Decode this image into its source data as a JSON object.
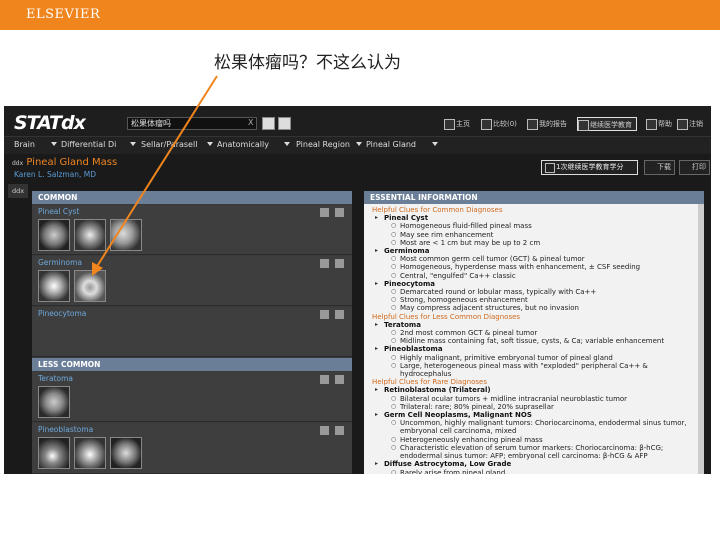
{
  "slide": {
    "brand": "ELSEVIER",
    "caption": "松果体瘤吗？不这么认为",
    "accent_color": "#f0851e"
  },
  "app": {
    "logo": "STATdx",
    "search_value": "松果体瘤吗",
    "search_clear": "X",
    "header_buttons": [
      "主页",
      "比较(0)",
      "我的报告",
      "继续医学教育",
      "帮助",
      "注销"
    ],
    "nav": [
      "Brain",
      "Differential Di",
      "Sellar/Parasell",
      "Anatomically",
      "Pineal Region",
      "Pineal Gland"
    ],
    "title_prefix": "ddx",
    "title": "Pineal Gland Mass",
    "author": "Karen L. Salzman, MD",
    "tm_button": "1次继续医学教育学分",
    "small_buttons": [
      "下载",
      "打印"
    ],
    "side_tab": "ddx"
  },
  "left": {
    "common_header": "COMMON",
    "less_common_header": "LESS COMMON",
    "common": [
      "Pineal Cyst",
      "Germinoma",
      "Pineocytoma"
    ],
    "less_common": [
      "Teratoma",
      "Pineoblastoma"
    ]
  },
  "right": {
    "header": "ESSENTIAL INFORMATION",
    "lines": [
      {
        "t": "h",
        "s": "Helpful Clues for Common Diagnoses"
      },
      {
        "t": "l1",
        "s": "Pineal Cyst"
      },
      {
        "t": "l2",
        "s": "Homogeneous fluid-filled pineal mass"
      },
      {
        "t": "l2",
        "s": "May see rim enhancement"
      },
      {
        "t": "l2",
        "s": "Most are < 1 cm but may be up to 2 cm"
      },
      {
        "t": "l1",
        "s": "Germinoma"
      },
      {
        "t": "l2",
        "s": "Most common germ cell tumor (GCT) & pineal tumor"
      },
      {
        "t": "l2",
        "s": "Homogeneous, hyperdense mass with enhancement, ± CSF seeding"
      },
      {
        "t": "l2",
        "s": "Central, \"engulfed\" Ca++ classic"
      },
      {
        "t": "l1",
        "s": "Pineocytoma"
      },
      {
        "t": "l2",
        "s": "Demarcated round or lobular mass, typically with Ca++"
      },
      {
        "t": "l2",
        "s": "Strong, homogeneous enhancement"
      },
      {
        "t": "l2",
        "s": "May compress adjacent structures, but no invasion"
      },
      {
        "t": "h",
        "s": "Helpful Clues for Less Common Diagnoses"
      },
      {
        "t": "l1",
        "s": "Teratoma"
      },
      {
        "t": "l2",
        "s": "2nd most common GCT & pineal tumor"
      },
      {
        "t": "l2",
        "s": "Midline mass containing fat, soft tissue, cysts, & Ca; variable enhancement"
      },
      {
        "t": "l1",
        "s": "Pineoblastoma"
      },
      {
        "t": "l2",
        "s": "Highly malignant, primitive embryonal tumor of pineal gland"
      },
      {
        "t": "l2",
        "s": "Large, heterogeneous pineal mass with \"exploded\" peripheral Ca++ &"
      },
      {
        "t": "cont",
        "s": "hydrocephalus"
      },
      {
        "t": "h",
        "s": "Helpful Clues for Rare Diagnoses"
      },
      {
        "t": "l1",
        "s": "Retinoblastoma (Trilateral)"
      },
      {
        "t": "l2",
        "s": "Bilateral ocular tumors + midline intracranial neuroblastic tumor"
      },
      {
        "t": "l2",
        "s": "Trilateral: rare; 80% pineal, 20% suprasellar"
      },
      {
        "t": "l1",
        "s": "Germ Cell Neoplasms, Malignant NOS"
      },
      {
        "t": "l2",
        "s": "Uncommon, highly malignant tumors: Choriocarcinoma, endodermal sinus tumor,"
      },
      {
        "t": "cont",
        "s": "embryonal cell carcinoma, mixed"
      },
      {
        "t": "l2",
        "s": "Heterogeneously enhancing pineal mass"
      },
      {
        "t": "l2",
        "s": "Characteristic elevation of serum tumor markers: Choriocarcinoma: β-hCG;"
      },
      {
        "t": "cont",
        "s": "endodermal sinus tumor: AFP; embryonal cell carcinoma: β-hCG & AFP"
      },
      {
        "t": "l1",
        "s": "Diffuse Astrocytoma, Low Grade"
      },
      {
        "t": "l2",
        "s": "Rarely arise from pineal gland"
      }
    ]
  }
}
